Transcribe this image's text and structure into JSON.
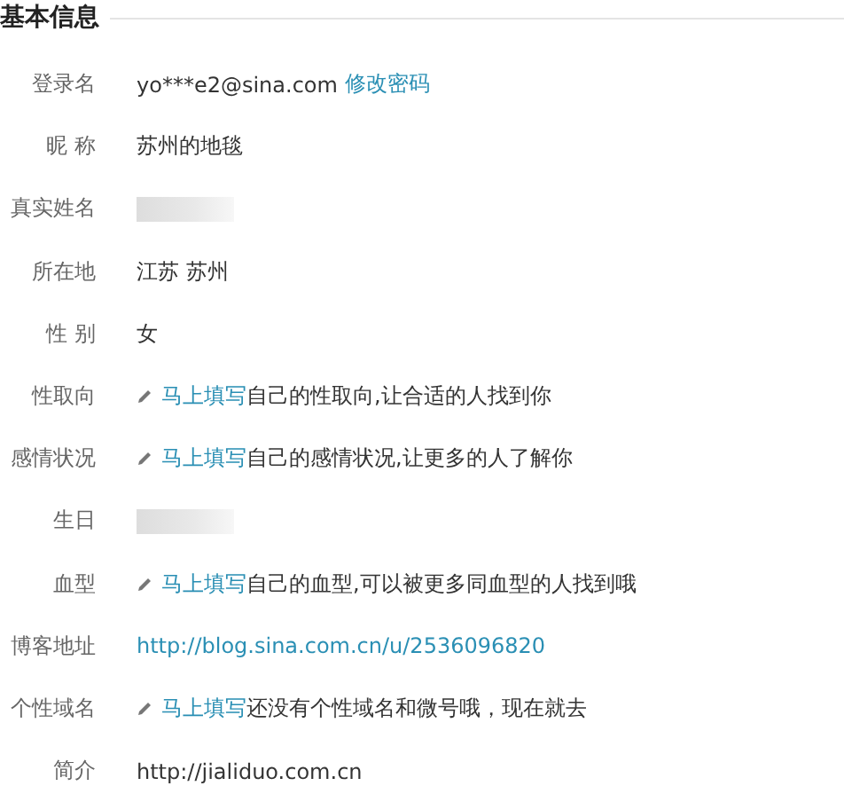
{
  "section_title": "基本信息",
  "rows": [
    {
      "label": "登录名",
      "kind": "text",
      "value": "yo***e2@sina.com",
      "link": "修改密码"
    },
    {
      "label": "昵 称",
      "kind": "text",
      "value": "苏州的地毯"
    },
    {
      "label": "真实姓名",
      "kind": "redacted"
    },
    {
      "label": "所在地",
      "kind": "text",
      "value": "江苏 苏州"
    },
    {
      "label": "性 别",
      "kind": "text",
      "value": "女"
    },
    {
      "label": "性取向",
      "kind": "prompt",
      "link": "马上填写",
      "value": "自己的性取向,让合适的人找到你"
    },
    {
      "label": "感情状况",
      "kind": "prompt",
      "link": "马上填写",
      "value": "自己的感情状况,让更多的人了解你"
    },
    {
      "label": "生日",
      "kind": "redacted"
    },
    {
      "label": "血型",
      "kind": "prompt",
      "link": "马上填写",
      "value": "自己的血型,可以被更多同血型的人找到哦"
    },
    {
      "label": "博客地址",
      "kind": "url",
      "link": "http://blog.sina.com.cn/u/2536096820"
    },
    {
      "label": "个性域名",
      "kind": "prompt",
      "link": "马上填写",
      "value": "还没有个性域名和微号哦，现在就去"
    },
    {
      "label": "简介",
      "kind": "text",
      "value": "http://jialiduo.com.cn"
    }
  ]
}
